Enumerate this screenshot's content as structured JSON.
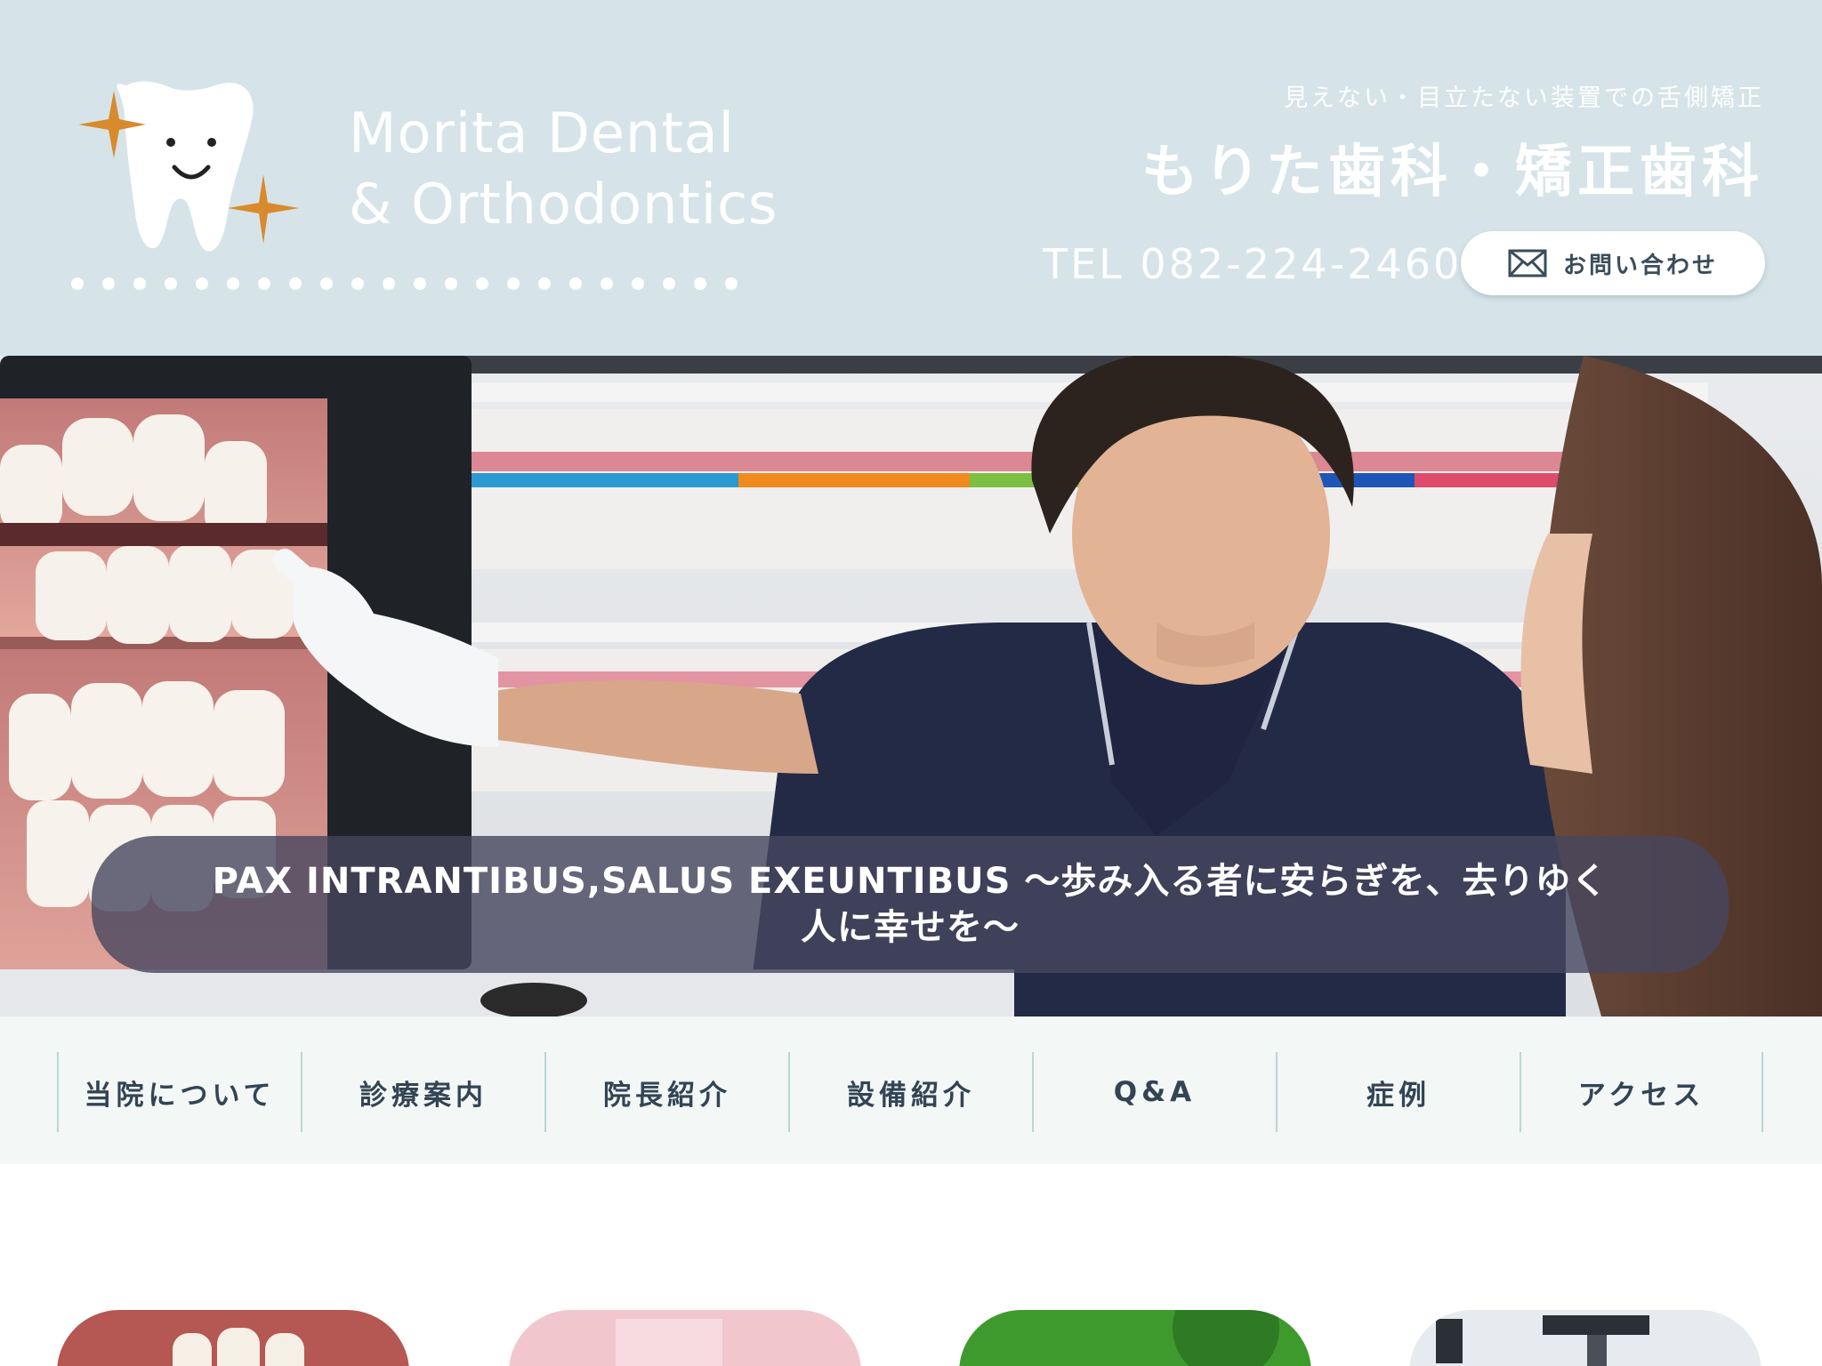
{
  "header": {
    "logo_en_line1": "Morita Dental",
    "logo_en_line2": "& Orthodontics",
    "tagline": "見えない・目立たない装置での舌側矯正",
    "clinic_name": "もりた歯科・矯正歯科",
    "tel": "TEL 082-224-2460",
    "contact_label": "お問い合わせ"
  },
  "hero": {
    "motto": "PAX INTRANTIBUS,SALUS EXEUNTIBUS ～歩み入る者に安らぎを、去りゆく人に幸せを～"
  },
  "nav": {
    "items": [
      "当院について",
      "診療案内",
      "院長紹介",
      "設備紹介",
      "Q&A",
      "症例",
      "アクセス"
    ]
  },
  "colors": {
    "header_bg": "#d6e4e9",
    "logo_star": "#d98a2c",
    "nav_bg": "#f3f7f6",
    "nav_divider": "#b9d7d4",
    "motto_bg": "#46465f"
  },
  "icons": {
    "contact": "envelope-icon",
    "logo": "tooth-mascot-icon"
  }
}
